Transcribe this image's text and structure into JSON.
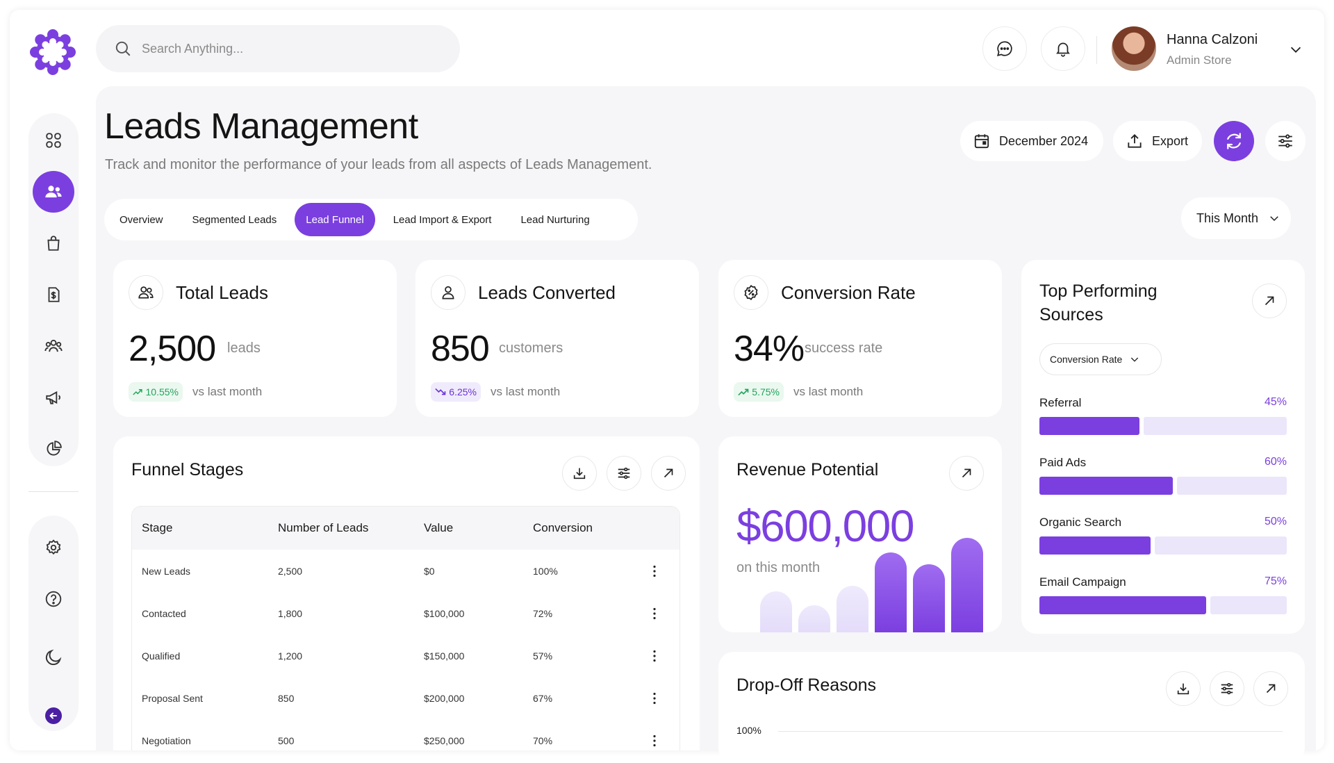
{
  "search": {
    "placeholder": "Search Anything..."
  },
  "user": {
    "name": "Hanna Calzoni",
    "role": "Admin Store"
  },
  "page": {
    "title": "Leads Management",
    "subtitle": "Track and monitor the performance of your leads from all aspects of Leads Management."
  },
  "header_actions": {
    "date": "December 2024",
    "export": "Export"
  },
  "tabs": [
    {
      "label": "Overview",
      "active": false
    },
    {
      "label": "Segmented Leads",
      "active": false
    },
    {
      "label": "Lead Funnel",
      "active": true
    },
    {
      "label": "Lead Import & Export",
      "active": false
    },
    {
      "label": "Lead Nurturing",
      "active": false
    }
  ],
  "period_select": {
    "value": "This Month"
  },
  "stats": [
    {
      "title": "Total Leads",
      "value": "2,500",
      "unit": "leads",
      "delta": "10.55%",
      "trend": "up",
      "note": "vs last month"
    },
    {
      "title": "Leads Converted",
      "value": "850",
      "unit": "customers",
      "delta": "6.25%",
      "trend": "down",
      "note": "vs last month"
    },
    {
      "title": "Conversion Rate",
      "value": "34%",
      "unit": "success rate",
      "delta": "5.75%",
      "trend": "up",
      "note": "vs last month"
    }
  ],
  "funnel": {
    "title": "Funnel Stages",
    "columns": [
      "Stage",
      "Number of Leads",
      "Value",
      "Conversion"
    ],
    "rows": [
      [
        "New Leads",
        "2,500",
        "$0",
        "100%"
      ],
      [
        "Contacted",
        "1,800",
        "$100,000",
        "72%"
      ],
      [
        "Qualified",
        "1,200",
        "$150,000",
        "57%"
      ],
      [
        "Proposal Sent",
        "850",
        "$200,000",
        "67%"
      ],
      [
        "Negotiation",
        "500",
        "$250,000",
        "70%"
      ]
    ]
  },
  "revenue": {
    "title": "Revenue Potential",
    "amount": "$600,000",
    "note": "on this month",
    "bars": [
      0.42,
      0.28,
      0.48,
      0.82,
      0.7,
      0.97
    ]
  },
  "sources": {
    "title": "Top Performing Sources",
    "metric": "Conversion Rate",
    "items": [
      {
        "label": "Referral",
        "pct_label": "45%",
        "value": 0.45
      },
      {
        "label": "Paid Ads",
        "pct_label": "60%",
        "value": 0.6
      },
      {
        "label": "Organic Search",
        "pct_label": "50%",
        "value": 0.5
      },
      {
        "label": "Email Campaign",
        "pct_label": "75%",
        "value": 0.75
      }
    ]
  },
  "dropoff": {
    "title": "Drop-Off Reasons",
    "axis_top": "100%"
  },
  "colors": {
    "accent": "#7b3fe0",
    "accent_light": "#ece6fb",
    "up": "#22a45d"
  }
}
